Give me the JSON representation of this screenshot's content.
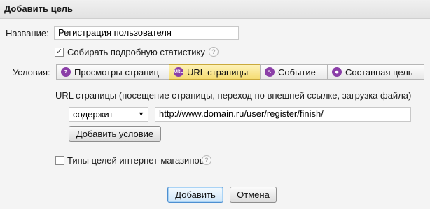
{
  "dialog": {
    "title": "Добавить цель"
  },
  "name_field": {
    "label": "Название:",
    "value": "Регистрация пользователя"
  },
  "detailed_stats": {
    "label": "Собирать подробную статистику",
    "checked": true,
    "help": "?"
  },
  "conditions": {
    "label": "Условия:",
    "tabs": [
      {
        "label": "Просмотры страниц",
        "icon": "pageviews-icon",
        "icon_text": "7",
        "color": "#8b3fa8",
        "active": false
      },
      {
        "label": "URL страницы",
        "icon": "url-icon",
        "icon_text": "URL",
        "color": "#8b3fa8",
        "active": true
      },
      {
        "label": "Событие",
        "icon": "event-icon",
        "icon_text": "↖",
        "color": "#8b3fa8",
        "active": false
      },
      {
        "label": "Составная цель",
        "icon": "composite-icon",
        "icon_text": "◆",
        "color": "#8b3fa8",
        "active": false
      }
    ]
  },
  "url_section": {
    "description": "URL страницы (посещение страницы, переход по внешней ссылке, загрузка файла)",
    "match_select": {
      "value": "содержит"
    },
    "url_value": "http://www.domain.ru/user/register/finish/",
    "add_condition_label": "Добавить условие"
  },
  "ecommerce": {
    "label": "Типы целей интернет-магазинов",
    "checked": false,
    "help": "?"
  },
  "actions": {
    "add_label": "Добавить",
    "cancel_label": "Отмена"
  }
}
